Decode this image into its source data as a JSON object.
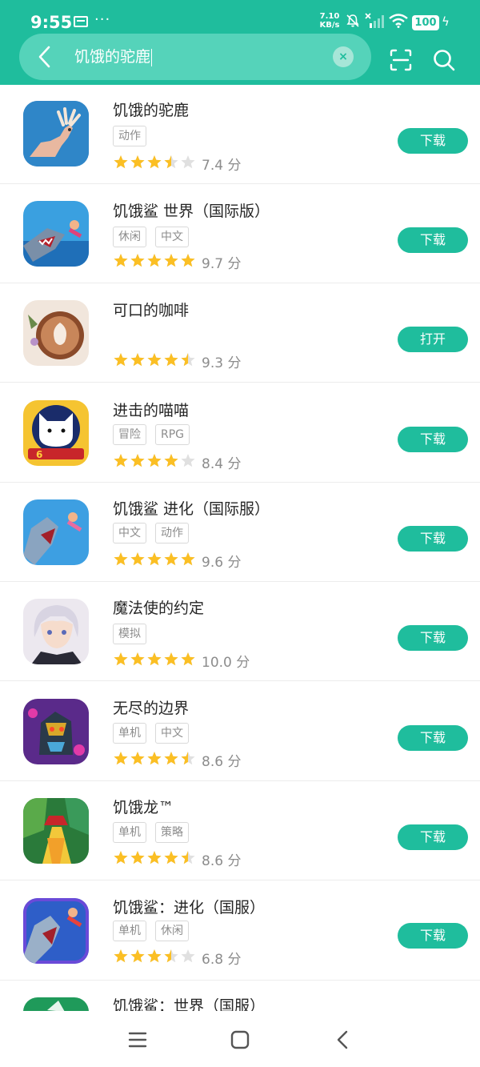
{
  "status_bar": {
    "time": "9:55",
    "more": "···",
    "net_speed_value": "7.10",
    "net_speed_unit": "KB/s",
    "battery": "100",
    "bolt": "ϟ"
  },
  "search": {
    "query": "饥饿的驼鹿",
    "clear_glyph": "×"
  },
  "colors": {
    "accent": "#1fbd9d",
    "star": "#fbbf24",
    "star_empty": "#e0e0e0"
  },
  "results": [
    {
      "name": "饥饿的驼鹿",
      "tags": [
        "动作"
      ],
      "rating": 3.5,
      "score": "7.4 分",
      "button": "下载",
      "icon": "moose-game-icon"
    },
    {
      "name": "饥饿鲨 世界（国际版）",
      "tags": [
        "休闲",
        "中文"
      ],
      "rating": 5,
      "score": "9.7 分",
      "button": "下载",
      "icon": "shark-world-icon"
    },
    {
      "name": "可口的咖啡",
      "tags": [],
      "rating": 4.5,
      "score": "9.3 分",
      "button": "打开",
      "icon": "coffee-latte-icon"
    },
    {
      "name": "进击的喵喵",
      "tags": [
        "冒险",
        "RPG"
      ],
      "rating": 4,
      "score": "8.4 分",
      "button": "下载",
      "icon": "cat-game-icon"
    },
    {
      "name": "饥饿鲨 进化（国际服）",
      "tags": [
        "中文",
        "动作"
      ],
      "rating": 5,
      "score": "9.6 分",
      "button": "下载",
      "icon": "shark-evolution-icon"
    },
    {
      "name": "魔法使的约定",
      "tags": [
        "模拟"
      ],
      "rating": 5,
      "score": "10.0 分",
      "button": "下载",
      "icon": "anime-character-icon"
    },
    {
      "name": "无尽的边界",
      "tags": [
        "单机",
        "中文"
      ],
      "rating": 4.5,
      "score": "8.6 分",
      "button": "下载",
      "icon": "robot-mech-icon"
    },
    {
      "name": "饥饿龙™",
      "tags": [
        "单机",
        "策略"
      ],
      "rating": 4.5,
      "score": "8.6 分",
      "button": "下载",
      "icon": "dragon-game-icon"
    },
    {
      "name": "饥饿鲨：进化（国服）",
      "tags": [
        "单机",
        "休闲"
      ],
      "rating": 3.5,
      "score": "6.8 分",
      "button": "下载",
      "icon": "shark-evolution-cn-icon"
    },
    {
      "name": "饥饿鲨：世界（国服）",
      "tags": [],
      "rating": 0,
      "score": "",
      "button": "",
      "icon": "shark-world-cn-icon"
    }
  ]
}
